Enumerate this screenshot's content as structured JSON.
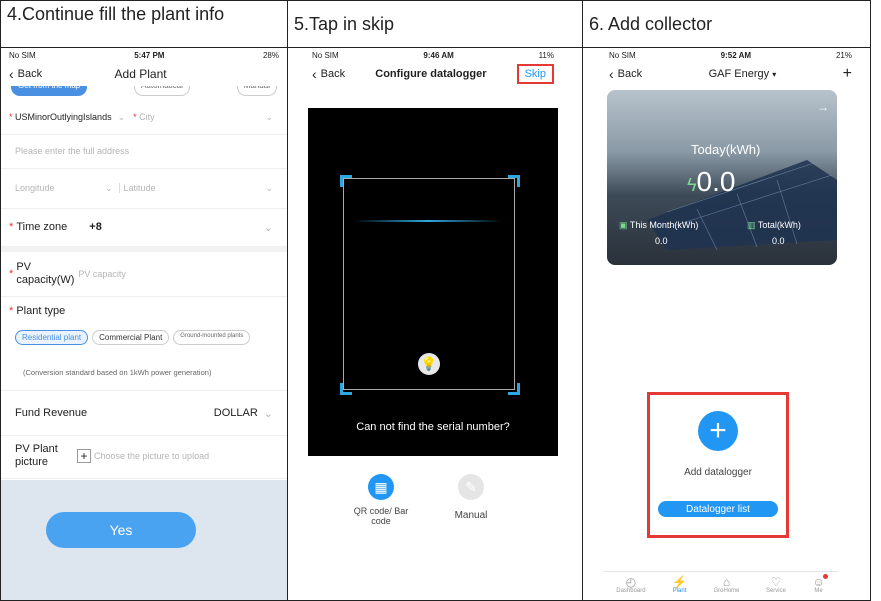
{
  "captions": {
    "step4": "4.Continue fill the plant info",
    "step5": "5.Tap in skip",
    "step6": "6. Add collector"
  },
  "panel4": {
    "status": {
      "carrier": "No SIM",
      "time": "5:47 PM",
      "battery": "28%"
    },
    "nav": {
      "back": "Back",
      "title": "Add Plant"
    },
    "top_tabs": [
      "Get from the map",
      "Automatical",
      "Manual"
    ],
    "region": "USMinorOutlyingIslands",
    "city_placeholder": "City",
    "address_placeholder": "Please enter the full address",
    "longitude_placeholder": "Longitude",
    "latitude_placeholder": "Latitude",
    "timezone_label": "Time zone",
    "timezone_value": "+8",
    "pv_capacity_label": "PV capacity(W)",
    "pv_capacity_placeholder": "PV capacity",
    "plant_type_label": "Plant type",
    "plant_types": [
      "Residential plant",
      "Commercial Plant",
      "Ground-mounted plants"
    ],
    "conversion_note": "(Conversion standard based on 1kWh power generation)",
    "fund_revenue_label": "Fund Revenue",
    "fund_revenue_value": "DOLLAR",
    "picture_label": "PV Plant picture",
    "picture_hint": "Choose the picture to upload",
    "yes": "Yes",
    "required_mark": "*"
  },
  "panel5": {
    "status": {
      "carrier": "No SIM",
      "time": "9:46 AM",
      "battery": "11%"
    },
    "nav": {
      "back": "Back",
      "title": "Configure datalogger",
      "skip": "Skip"
    },
    "not_found": "Can not find the serial number?",
    "qr_label": "QR code/ Bar code",
    "manual_label": "Manual"
  },
  "panel6": {
    "status": {
      "carrier": "No SIM",
      "time": "9:52 AM",
      "battery": "21%"
    },
    "nav": {
      "back": "Back",
      "title": "GAF Energy",
      "plus": "+"
    },
    "today_label": "Today(kWh)",
    "today_value": "0.0",
    "month_label": "This Month(kWh)",
    "month_value": "0.0",
    "total_label": "Total(kWh)",
    "total_value": "0.0",
    "add_datalogger": "Add datalogger",
    "datalogger_list": "Datalogger list",
    "tabs": [
      "Dashboard",
      "Plant",
      "GroHome",
      "Service",
      "Me"
    ]
  },
  "colors": {
    "accent": "#2196f3",
    "highlight": "#e53935",
    "scan": "#2ea7e0"
  }
}
